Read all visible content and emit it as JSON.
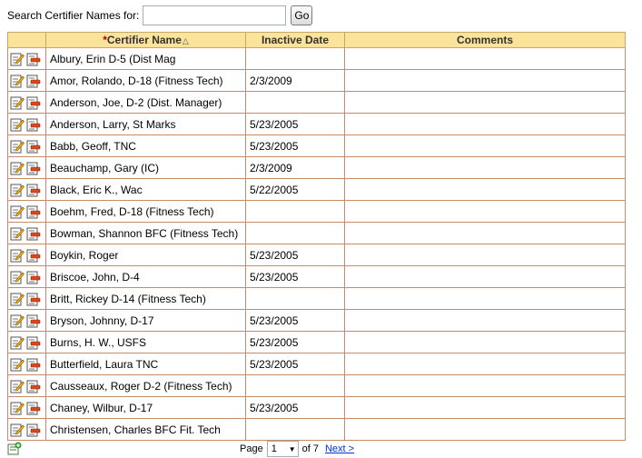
{
  "search": {
    "label": "Search Certifier Names for:",
    "value": "",
    "placeholder": "",
    "go_label": "Go"
  },
  "table": {
    "columns": [
      {
        "required_mark": "*",
        "label": "Certifier Name",
        "sort_indicator": "△"
      },
      {
        "label": "Inactive Date"
      },
      {
        "label": "Comments"
      }
    ],
    "rows": [
      {
        "name": "Albury, Erin D-5 (Dist Mag",
        "inactive_date": "",
        "comments": ""
      },
      {
        "name": "Amor, Rolando, D-18 (Fitness Tech)",
        "inactive_date": "2/3/2009",
        "comments": ""
      },
      {
        "name": "Anderson, Joe, D-2 (Dist. Manager)",
        "inactive_date": "",
        "comments": ""
      },
      {
        "name": "Anderson, Larry, St Marks",
        "inactive_date": "5/23/2005",
        "comments": ""
      },
      {
        "name": "Babb, Geoff, TNC",
        "inactive_date": "5/23/2005",
        "comments": ""
      },
      {
        "name": "Beauchamp, Gary (IC)",
        "inactive_date": "2/3/2009",
        "comments": ""
      },
      {
        "name": "Black, Eric K., Wac",
        "inactive_date": "5/22/2005",
        "comments": ""
      },
      {
        "name": "Boehm, Fred, D-18 (Fitness Tech)",
        "inactive_date": "",
        "comments": ""
      },
      {
        "name": "Bowman, Shannon BFC (Fitness Tech)",
        "inactive_date": "",
        "comments": ""
      },
      {
        "name": "Boykin, Roger",
        "inactive_date": "5/23/2005",
        "comments": ""
      },
      {
        "name": "Briscoe, John, D-4",
        "inactive_date": "5/23/2005",
        "comments": ""
      },
      {
        "name": "Britt, Rickey D-14 (Fitness Tech)",
        "inactive_date": "",
        "comments": ""
      },
      {
        "name": "Bryson, Johnny, D-17",
        "inactive_date": "5/23/2005",
        "comments": ""
      },
      {
        "name": "Burns, H. W., USFS",
        "inactive_date": "5/23/2005",
        "comments": ""
      },
      {
        "name": "Butterfield, Laura TNC",
        "inactive_date": "5/23/2005",
        "comments": ""
      },
      {
        "name": "Causseaux, Roger D-2 (Fitness Tech)",
        "inactive_date": "",
        "comments": ""
      },
      {
        "name": "Chaney, Wilbur, D-17",
        "inactive_date": "5/23/2005",
        "comments": ""
      },
      {
        "name": "Christensen, Charles BFC Fit. Tech",
        "inactive_date": "",
        "comments": ""
      }
    ]
  },
  "icons": {
    "edit": "edit-icon",
    "delete": "delete-icon",
    "add": "add-record-icon"
  },
  "pager": {
    "page_label": "Page",
    "current_page": "1",
    "of_label": "of 7",
    "next_label": "Next >"
  },
  "colors": {
    "header_bg": "#fbe39a",
    "row_border": "#c98a6a",
    "link": "#0033cc",
    "required": "#c00000"
  }
}
